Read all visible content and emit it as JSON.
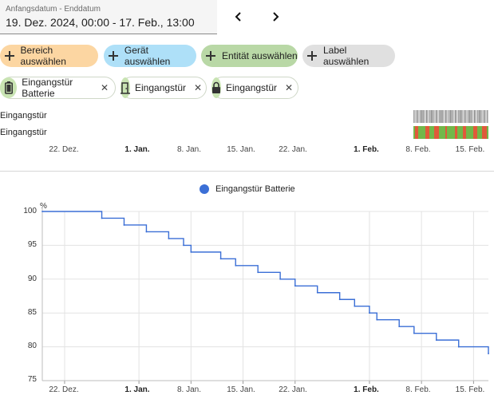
{
  "date_picker": {
    "label": "Anfangsdatum - Enddatum",
    "value": "19. Dez. 2024, 00:00 - 17. Feb., 13:00"
  },
  "nav": {
    "prev_icon": "chevron-left-icon",
    "next_icon": "chevron-right-icon"
  },
  "target_buttons": [
    {
      "label": "Bereich auswählen",
      "color": "#fcd6a2"
    },
    {
      "label": "Gerät auswählen",
      "color": "#aee0f8"
    },
    {
      "label": "Entität auswählen",
      "color": "#b9d8a6"
    },
    {
      "label": "Label auswählen",
      "color": "#e0e0e0"
    }
  ],
  "chips": [
    {
      "label": "Eingangstür Batterie",
      "icon": "battery-icon"
    },
    {
      "label": "Eingangstür",
      "icon": "door-icon"
    },
    {
      "label": "Eingangstür",
      "icon": "lock-icon"
    }
  ],
  "timeline": {
    "rows": [
      "Eingangstür",
      "Eingangstür"
    ],
    "colors": {
      "gray": "#9e9e9e",
      "green": "#72b84a",
      "red": "#e05a3a"
    }
  },
  "axis": {
    "x_ticks": [
      {
        "label": "22. Dez.",
        "bold": false
      },
      {
        "label": "1. Jan.",
        "bold": true
      },
      {
        "label": "8. Jan.",
        "bold": false
      },
      {
        "label": "15. Jan.",
        "bold": false
      },
      {
        "label": "22. Jan.",
        "bold": false
      },
      {
        "label": "1. Feb.",
        "bold": true
      },
      {
        "label": "8. Feb.",
        "bold": false
      },
      {
        "label": "15. Feb.",
        "bold": false
      }
    ]
  },
  "chart_data": {
    "type": "line",
    "series": [
      {
        "name": "Eingangstür Batterie",
        "color": "#3b6fd6",
        "x": [
          "19. Dez.",
          "27. Dez.",
          "30. Dez.",
          "2. Jan.",
          "5. Jan.",
          "7. Jan.",
          "8. Jan.",
          "12. Jan.",
          "14. Jan.",
          "17. Jan.",
          "20. Jan.",
          "22. Jan.",
          "25. Jan.",
          "28. Jan.",
          "30. Jan.",
          "1. Feb.",
          "2. Feb.",
          "5. Feb.",
          "7. Feb.",
          "10. Feb.",
          "13. Feb.",
          "17. Feb."
        ],
        "values": [
          100,
          99,
          98,
          97,
          96,
          95,
          94,
          93,
          92,
          91,
          90,
          89,
          88,
          87,
          86,
          85,
          84,
          83,
          82,
          81,
          80,
          79
        ]
      }
    ],
    "ylabel": "%",
    "ylim": [
      75,
      100
    ],
    "y_ticks": [
      100,
      95,
      90,
      85,
      80,
      75
    ],
    "xlim": [
      "19. Dez.",
      "17. Feb."
    ],
    "grid": true
  }
}
